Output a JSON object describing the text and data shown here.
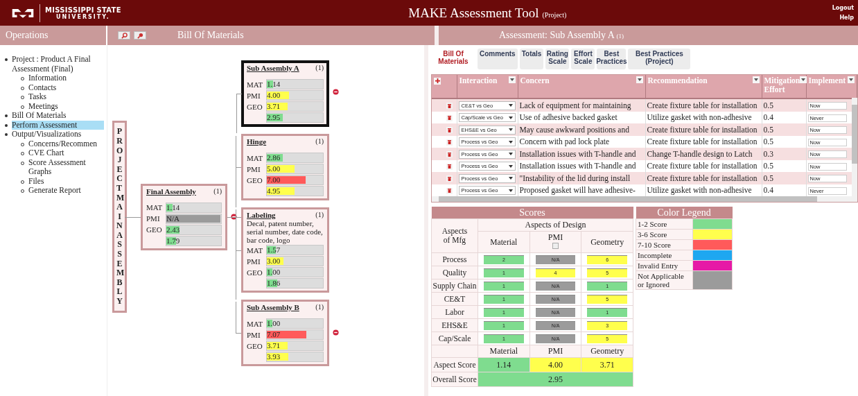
{
  "header": {
    "logo_line1": "MISSISSIPPI STATE",
    "logo_line2": "UNIVERSITY.",
    "title": "MAKE Assessment Tool",
    "title_note": "(Project)",
    "links": [
      "Logout",
      "Help"
    ]
  },
  "left_panel": {
    "title": "Operations"
  },
  "bom_panel": {
    "title": "Bill Of Materials"
  },
  "sidebar": {
    "items": [
      {
        "label": "Project : Product A Final Assessment (Final)",
        "selected": false,
        "children": [
          {
            "label": "Information",
            "selected": false
          },
          {
            "label": "Contacts",
            "selected": false
          },
          {
            "label": "Tasks",
            "selected": false
          },
          {
            "label": "Meetings",
            "selected": false
          }
        ]
      },
      {
        "label": "Bill Of Materials",
        "selected": false
      },
      {
        "label": "Perform Assessment",
        "selected": true
      },
      {
        "label": "Output/Visualizations",
        "selected": false,
        "children": [
          {
            "label": "Concerns/Recommen",
            "selected": false
          },
          {
            "label": "CVE Chart",
            "selected": false
          },
          {
            "label": "Score Assessment Graphs",
            "selected": false
          },
          {
            "label": "Files",
            "selected": false
          },
          {
            "label": "Generate Report",
            "selected": false
          }
        ]
      }
    ]
  },
  "bom": {
    "root": "PROJECT MAIN ASSEMBLY",
    "nodes": [
      {
        "title": "Final Assembly",
        "count": "(1)",
        "selected": false,
        "expanded": true,
        "rows": [
          {
            "label": "MAT",
            "value": "1.14",
            "level": 0.12,
            "color": "#7fdc8f"
          },
          {
            "label": "PMI",
            "value": "N/A",
            "level": 1,
            "color": "#9b9b9b"
          },
          {
            "label": "GEO",
            "value": "2.43",
            "level": 0.24,
            "color": "#7fdc8f"
          },
          {
            "value": "1.79",
            "level": 0.18,
            "color": "#7fdc8f"
          }
        ]
      },
      {
        "title": "Sub Assembly A",
        "count": "(1)",
        "selected": true,
        "expanded": true,
        "rows": [
          {
            "label": "MAT",
            "value": "1.14",
            "level": 0.11,
            "color": "#7fdc8f"
          },
          {
            "label": "PMI",
            "value": "4.00",
            "level": 0.4,
            "color": "#ffff4d"
          },
          {
            "label": "GEO",
            "value": "3.71",
            "level": 0.37,
            "color": "#ffff4d"
          },
          {
            "value": "2.95",
            "level": 0.29,
            "color": "#7fdc8f"
          }
        ]
      },
      {
        "title": "Hinge",
        "count": "(1)",
        "selected": false,
        "rows": [
          {
            "label": "MAT",
            "value": "2.86",
            "level": 0.29,
            "color": "#7fdc8f"
          },
          {
            "label": "PMI",
            "value": "5.00",
            "level": 0.5,
            "color": "#ffff4d"
          },
          {
            "label": "GEO",
            "value": "7.00",
            "level": 0.7,
            "color": "#ff5a5a"
          },
          {
            "value": "4.95",
            "level": 0.5,
            "color": "#ffff4d"
          }
        ]
      },
      {
        "title": "Labeling",
        "count": "(1)",
        "selected": false,
        "description": "Decal, patent number, serial number, date code, bar code, logo",
        "rows": [
          {
            "label": "MAT",
            "value": "1.57",
            "level": 0.16,
            "color": "#7fdc8f"
          },
          {
            "label": "PMI",
            "value": "3.00",
            "level": 0.3,
            "color": "#ffff4d"
          },
          {
            "label": "GEO",
            "value": "1.00",
            "level": 0.1,
            "color": "#7fdc8f"
          },
          {
            "value": "1.86",
            "level": 0.19,
            "color": "#7fdc8f"
          }
        ]
      },
      {
        "title": "Sub Assembly B",
        "count": "(1)",
        "selected": false,
        "expanded": true,
        "rows": [
          {
            "label": "MAT",
            "value": "1.00",
            "level": 0.1,
            "color": "#7fdc8f"
          },
          {
            "label": "PMI",
            "value": "7.07",
            "level": 0.71,
            "color": "#ff5a5a"
          },
          {
            "label": "GEO",
            "value": "3.71",
            "level": 0.37,
            "color": "#ffff4d"
          },
          {
            "value": "3.93",
            "level": 0.39,
            "color": "#ffff4d"
          }
        ]
      }
    ]
  },
  "assessment": {
    "title": "Assessment: Sub Assembly A",
    "count": "(1)",
    "tabs": [
      {
        "label": "Bill Of Materials",
        "selected": true
      },
      {
        "label": "Comments",
        "selected": false
      },
      {
        "label": "Totals",
        "selected": false
      },
      {
        "label": "Rating Scale",
        "selected": false
      },
      {
        "label": "Effort Scale",
        "selected": false
      },
      {
        "label": "Best Practices",
        "selected": false
      },
      {
        "label": "Best Practices (Project)",
        "selected": false
      }
    ],
    "columns": [
      "Interaction",
      "Concern",
      "Recommendation",
      "Mitigation Effort",
      "Implement"
    ],
    "rows": [
      {
        "interaction": "CE&T vs Geo",
        "concern": "Lack of equipment for maintaining",
        "recommendation": "Create fixture table for installation",
        "effort": "0.5",
        "implement": "Now"
      },
      {
        "interaction": "Cap/Scale vs Geo",
        "concern": "Use of adhesive backed gasket",
        "recommendation": "Utilize gasket with non-adhesive",
        "effort": "0.4",
        "implement": "Never"
      },
      {
        "interaction": "EHS&E vs Geo",
        "concern": "May cause awkward positions and",
        "recommendation": "Create fixture table for installation",
        "effort": "0.5",
        "implement": "Now"
      },
      {
        "interaction": "Process vs Geo",
        "concern": "Concern with pad lock plate",
        "recommendation": "Create fixture table for installation",
        "effort": "0.5",
        "implement": "Now"
      },
      {
        "interaction": "Process vs Geo",
        "concern": "Installation issues with T-handle and",
        "recommendation": "Change T-handle design to Latch",
        "effort": "0.3",
        "implement": "Now"
      },
      {
        "interaction": "Process vs Geo",
        "concern": "Installation issues with T-handle and",
        "recommendation": "Create fixture table for installation",
        "effort": "0.5",
        "implement": "Now"
      },
      {
        "interaction": "Process vs Geo",
        "concern": "\"Instability of the lid during install",
        "recommendation": "Create fixture table for installation",
        "effort": "0.5",
        "implement": "Now"
      },
      {
        "interaction": "Process vs Geo",
        "concern": "Proposed gasket will have adhesive-",
        "recommendation": "Utilize gasket with non-adhesive",
        "effort": "0.4",
        "implement": "Never"
      }
    ]
  },
  "scores": {
    "title": "Scores",
    "mfg_heading": "Aspects of Mfg",
    "design_heading": "Aspects of Design",
    "columns": [
      "Material",
      "PMI",
      "Geometry"
    ],
    "pmi_checked": false,
    "rows": [
      {
        "label": "Process",
        "cells": [
          {
            "value": "2",
            "color": "#7fdc8f"
          },
          {
            "value": "N/A",
            "color": "#9b9b9b"
          },
          {
            "value": "6",
            "color": "#ffff4d"
          }
        ]
      },
      {
        "label": "Quality",
        "cells": [
          {
            "value": "1",
            "color": "#7fdc8f"
          },
          {
            "value": "4",
            "color": "#ffff4d"
          },
          {
            "value": "5",
            "color": "#ffff4d"
          }
        ]
      },
      {
        "label": "Supply Chain",
        "cells": [
          {
            "value": "1",
            "color": "#7fdc8f"
          },
          {
            "value": "N/A",
            "color": "#9b9b9b"
          },
          {
            "value": "1",
            "color": "#7fdc8f"
          }
        ]
      },
      {
        "label": "CE&T",
        "cells": [
          {
            "value": "1",
            "color": "#7fdc8f"
          },
          {
            "value": "N/A",
            "color": "#9b9b9b"
          },
          {
            "value": "5",
            "color": "#ffff4d"
          }
        ]
      },
      {
        "label": "Labor",
        "cells": [
          {
            "value": "1",
            "color": "#7fdc8f"
          },
          {
            "value": "N/A",
            "color": "#9b9b9b"
          },
          {
            "value": "1",
            "color": "#7fdc8f"
          }
        ]
      },
      {
        "label": "EHS&E",
        "cells": [
          {
            "value": "1",
            "color": "#7fdc8f"
          },
          {
            "value": "N/A",
            "color": "#9b9b9b"
          },
          {
            "value": "3",
            "color": "#ffff4d"
          }
        ]
      },
      {
        "label": "Cap/Scale",
        "cells": [
          {
            "value": "1",
            "color": "#7fdc8f"
          },
          {
            "value": "N/A",
            "color": "#9b9b9b"
          },
          {
            "value": "5",
            "color": "#ffff4d"
          }
        ]
      }
    ],
    "footer_columns": [
      "Material",
      "PMI",
      "Geometry"
    ],
    "aspect_label": "Aspect Score",
    "aspect_scores": [
      {
        "value": "1.14",
        "color": "#7fdc8f"
      },
      {
        "value": "4.00",
        "color": "#ffff4d"
      },
      {
        "value": "3.71",
        "color": "#ffff4d"
      }
    ],
    "overall_label": "Overall Score",
    "overall": {
      "value": "2.95",
      "color": "#7fdc8f"
    }
  },
  "legend": {
    "title": "Color Legend",
    "items": [
      {
        "label": "1-2 Score",
        "color": "#7fdc8f"
      },
      {
        "label": "3-6 Score",
        "color": "#ffff4d"
      },
      {
        "label": "7-10 Score",
        "color": "#ff5a5a"
      },
      {
        "label": "Incomplete",
        "color": "#1ea7f0"
      },
      {
        "label": "Invalid Entry",
        "color": "#e619a6"
      },
      {
        "label": "Not Applicable or Ignored",
        "color": "#9b9b9b"
      }
    ]
  }
}
